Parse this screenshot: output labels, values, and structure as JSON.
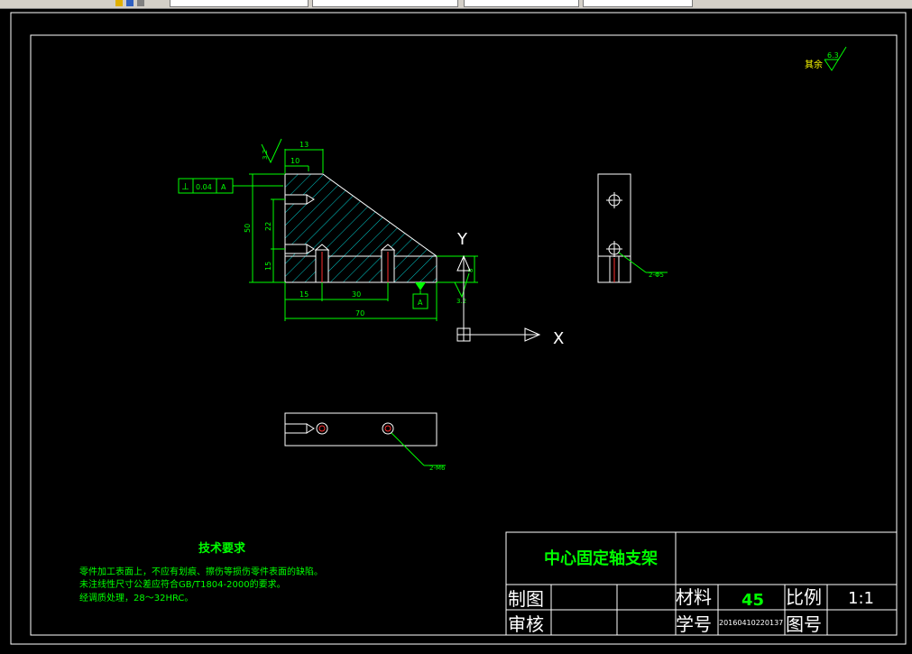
{
  "drawing": {
    "title": "中心固定轴支架",
    "roughness_note": {
      "label": "其余",
      "value": "6.3"
    },
    "roughness_marks": [
      "3.2",
      "3.2"
    ],
    "tolerance_frame": {
      "symbol": "⊥",
      "value": "0.04",
      "datum": "A"
    },
    "datum_label": "A",
    "dimensions": {
      "top_13": "13",
      "top_10": "10",
      "height_50": "50",
      "h_22": "22",
      "h_15": "15",
      "bottom_15": "15",
      "bottom_30": "30",
      "total_70": "70",
      "small_8": "8"
    },
    "axes": {
      "x": "X",
      "y": "Y"
    },
    "hole_callouts": {
      "side": "2-Φ5",
      "bottom": "2-M6"
    },
    "tech_requirements": {
      "title": "技术要求",
      "lines": [
        "零件加工表面上，不应有划痕、擦伤等损伤零件表面的缺陷。",
        "未注线性尺寸公差应符合GB/T1804-2000的要求。",
        "经调质处理，28～32HRC。"
      ]
    },
    "title_block": {
      "drawn_by_label": "制图",
      "review_label": "审核",
      "material_label": "材料",
      "material_value": "45",
      "scale_label": "比例",
      "scale_value": "1:1",
      "student_id_label": "学号",
      "student_id_value": "20160410220137",
      "drawing_no_label": "图号"
    }
  },
  "colors": {
    "background": "#000000",
    "white_lines": "#ffffff",
    "green_lines": "#00ff00",
    "hatch": "#00c8c8",
    "holes": "#ff3030",
    "text_green": "#00ff00"
  }
}
